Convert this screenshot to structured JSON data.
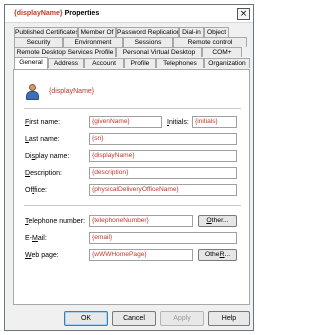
{
  "title": {
    "placeholder": "{displayName}",
    "suffix": "Properties",
    "close_glyph": "×"
  },
  "tabs": {
    "row1": [
      "Published Certificates",
      "Member Of",
      "Password Replication",
      "Dial-in",
      "Object"
    ],
    "row2": [
      "Security",
      "Environment",
      "Sessions",
      "Remote control"
    ],
    "row3": [
      "Remote Desktop Services Profile",
      "Personal Virtual Desktop",
      "COM+"
    ],
    "row4": [
      "General",
      "Address",
      "Account",
      "Profile",
      "Telephones",
      "Organization"
    ],
    "active": "General"
  },
  "general": {
    "display_name": "{displayName}",
    "first_name_key": "F",
    "first_name_rest": "irst name:",
    "first_name_value": "{givenName}",
    "initials_key": "I",
    "initials_rest": "nitials:",
    "initials_value": "{initials}",
    "last_name_key": "L",
    "last_name_rest": "ast name:",
    "last_name_value": "{sn}",
    "display_key": "s",
    "display_pre": "Di",
    "display_post": "play name:",
    "display_value": "{displayName}",
    "description_key": "D",
    "description_rest": "escription:",
    "description_value": "{description}",
    "office_key": "f",
    "office_pre": "Of",
    "office_post": "fice:",
    "office_value": "{physicalDeliveryOfficeName}",
    "telephone_key": "T",
    "telephone_rest": "elephone number:",
    "telephone_value": "{telephoneNumber}",
    "other_key": "O",
    "other_rest": "ther...",
    "email_key": "M",
    "email_pre": "E-",
    "email_post": "ail:",
    "email_value": "{email}",
    "webpage_key": "W",
    "webpage_rest": "eb page:",
    "webpage_value": "{wWWHomePage}",
    "other2_key": "R",
    "other2_pre": "Othe",
    "other2_post": "..."
  },
  "buttons": {
    "ok": "OK",
    "cancel": "Cancel",
    "apply": "Apply",
    "help": "Help"
  },
  "icons": {
    "user": "user-icon",
    "close": "close-icon"
  },
  "colors": {
    "placeholder_text": "#c0392b",
    "default_button_border": "#3c7fb1"
  }
}
